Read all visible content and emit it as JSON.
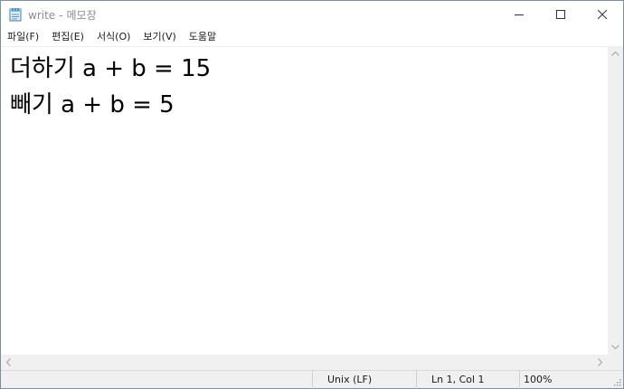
{
  "window": {
    "file_name": "write",
    "separator": "-",
    "app_name": "메모장"
  },
  "menu": {
    "items": [
      {
        "label": "파일(F)"
      },
      {
        "label": "편집(E)"
      },
      {
        "label": "서식(O)"
      },
      {
        "label": "보기(V)"
      },
      {
        "label": "도움말"
      }
    ]
  },
  "editor": {
    "lines": [
      "더하기 a + b = 15",
      "빼기 a + b = 5"
    ]
  },
  "statusbar": {
    "line_ending": "Unix (LF)",
    "position": "Ln 1, Col 1",
    "zoom": "100%"
  },
  "icons": {
    "app": "notepad-icon",
    "minimize": "minimize-icon",
    "maximize": "maximize-icon",
    "close": "close-icon"
  },
  "colors": {
    "border": "#7a8fa6",
    "title_text": "#8c8c8c",
    "scrollbar": "#f0f0f0",
    "statusbar": "#f0f0f0"
  }
}
